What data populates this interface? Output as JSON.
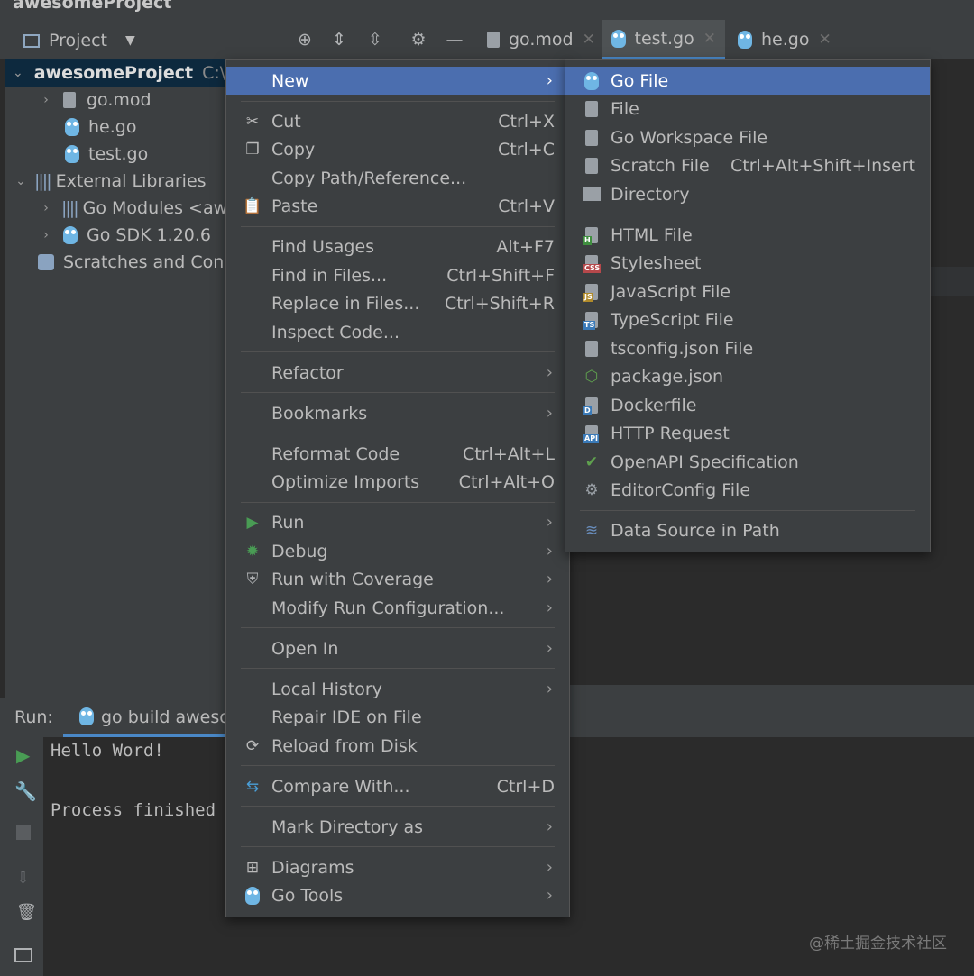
{
  "window": {
    "title": "awesomeProject"
  },
  "toolbar": {
    "project_label": "Project",
    "tabs": [
      {
        "label": "go.mod",
        "active": false
      },
      {
        "label": "test.go",
        "active": true
      },
      {
        "label": "he.go",
        "active": false
      }
    ]
  },
  "project_tree": {
    "root": {
      "label": "awesomeProject",
      "path": "C:\\"
    },
    "files": [
      "go.mod",
      "he.go",
      "test.go"
    ],
    "external_libraries": "External Libraries",
    "go_modules": "Go Modules <awe",
    "go_sdk": "Go SDK 1.20.6",
    "scratches": "Scratches and Consol"
  },
  "run": {
    "label": "Run:",
    "config": "go build aweson",
    "output_line1": "Hello Word!",
    "output_line2": "Process finished"
  },
  "context_menu": {
    "new": "New",
    "cut": "Cut",
    "cut_sc": "Ctrl+X",
    "copy": "Copy",
    "copy_sc": "Ctrl+C",
    "copy_path": "Copy Path/Reference...",
    "paste": "Paste",
    "paste_sc": "Ctrl+V",
    "find_usages": "Find Usages",
    "find_usages_sc": "Alt+F7",
    "find_in_files": "Find in Files...",
    "find_in_files_sc": "Ctrl+Shift+F",
    "replace_in_files": "Replace in Files...",
    "replace_in_files_sc": "Ctrl+Shift+R",
    "inspect_code": "Inspect Code...",
    "refactor": "Refactor",
    "bookmarks": "Bookmarks",
    "reformat_code": "Reformat Code",
    "reformat_code_sc": "Ctrl+Alt+L",
    "optimize_imports": "Optimize Imports",
    "optimize_imports_sc": "Ctrl+Alt+O",
    "run": "Run",
    "debug": "Debug",
    "run_coverage": "Run with Coverage",
    "modify_run": "Modify Run Configuration...",
    "open_in": "Open In",
    "local_history": "Local History",
    "repair_ide": "Repair IDE on File",
    "reload_disk": "Reload from Disk",
    "compare_with": "Compare With...",
    "compare_with_sc": "Ctrl+D",
    "mark_directory": "Mark Directory as",
    "diagrams": "Diagrams",
    "go_tools": "Go Tools"
  },
  "new_submenu": {
    "go_file": "Go File",
    "file": "File",
    "go_workspace": "Go Workspace File",
    "scratch": "Scratch File",
    "scratch_sc": "Ctrl+Alt+Shift+Insert",
    "directory": "Directory",
    "html": "HTML File",
    "stylesheet": "Stylesheet",
    "javascript": "JavaScript File",
    "typescript": "TypeScript File",
    "tsconfig": "tsconfig.json File",
    "package_json": "package.json",
    "dockerfile": "Dockerfile",
    "http_request": "HTTP Request",
    "openapi": "OpenAPI Specification",
    "editorconfig": "EditorConfig File",
    "data_source": "Data Source in Path",
    "badges": {
      "html": "H",
      "css": "CSS",
      "js": "JS",
      "ts": "TS",
      "dockerfile": "D",
      "api": "API"
    }
  },
  "watermark": "@稀土掘金技术社区",
  "colors": {
    "highlight": "#4b6eaf",
    "menu_bg": "#3c3f41",
    "editor_bg": "#2b2b2b",
    "run_green": "#499c54"
  }
}
